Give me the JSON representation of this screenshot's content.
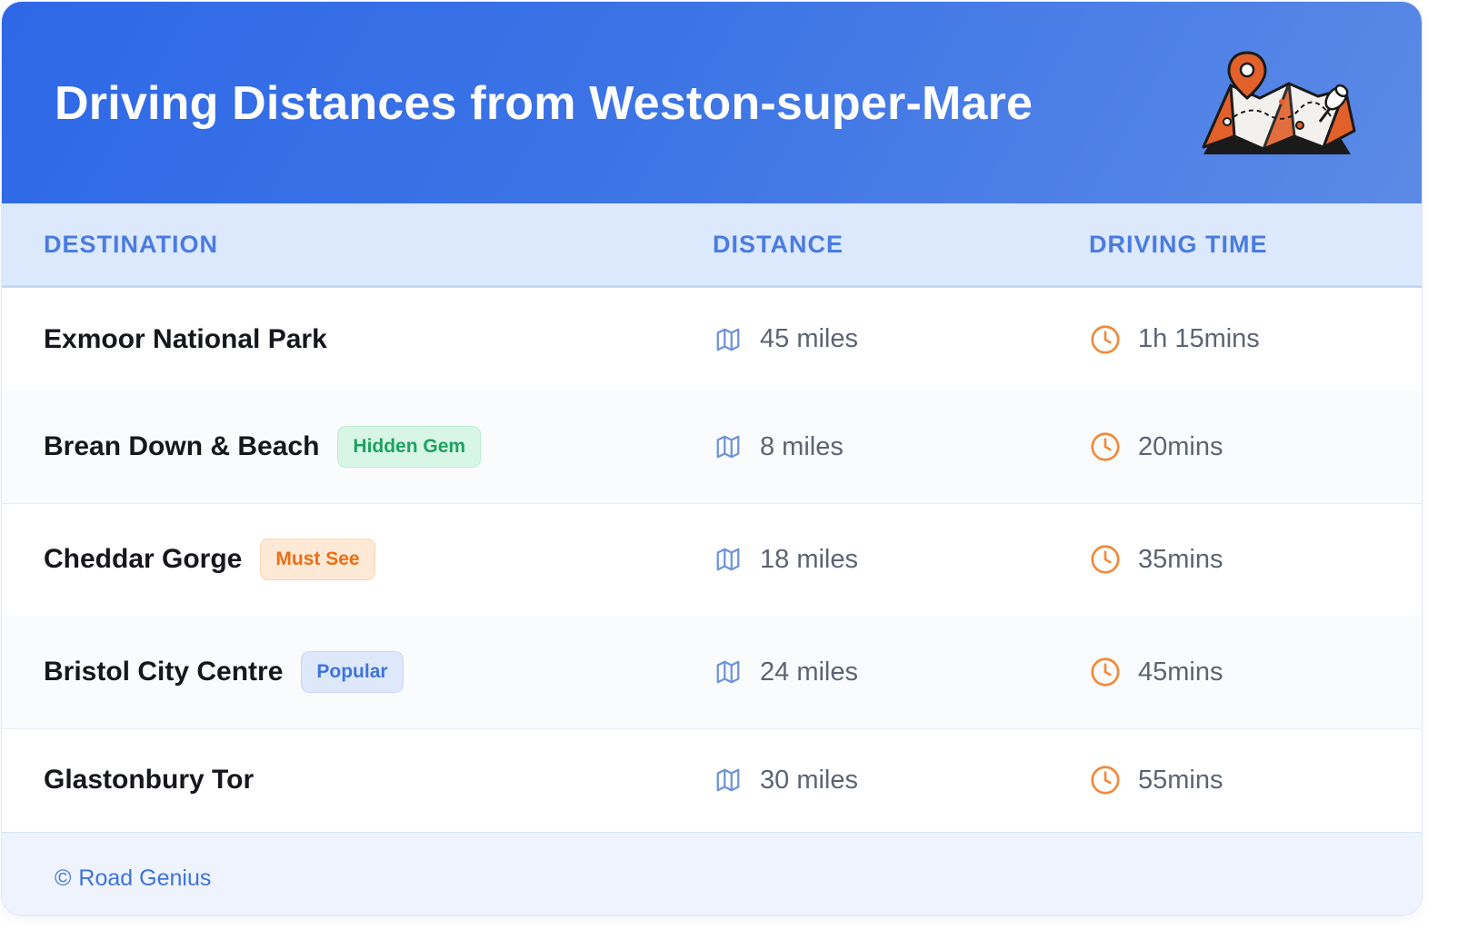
{
  "header": {
    "title": "Driving Distances from Weston-super-Mare",
    "illustration_icon": "map-with-pin-icon"
  },
  "table": {
    "columns": [
      "DESTINATION",
      "DISTANCE",
      "DRIVING TIME"
    ],
    "distance_icon": "map-icon",
    "time_icon": "clock-icon",
    "rows": [
      {
        "destination": "Exmoor National Park",
        "badge": "",
        "distance": "45 miles",
        "time": "1h 15mins"
      },
      {
        "destination": "Brean Down & Beach",
        "badge": "Hidden Gem",
        "badge_color": "#1ca25e",
        "distance": "8 miles",
        "time": "20mins"
      },
      {
        "destination": "Cheddar Gorge",
        "badge": "Must See",
        "badge_color": "#ee6d14",
        "distance": "18 miles",
        "time": "35mins"
      },
      {
        "destination": "Bristol City Centre",
        "badge": "Popular",
        "badge_color": "#3f73dd",
        "distance": "24 miles",
        "time": "45mins"
      },
      {
        "destination": "Glastonbury Tor",
        "badge": "",
        "distance": "30 miles",
        "time": "55mins"
      }
    ]
  },
  "footer": {
    "copyright_symbol": "©",
    "brand": "Road Genius"
  },
  "colors": {
    "header_start": "#2e68e6",
    "header_end": "#5b8ae6",
    "accent_blue": "#4a7be0",
    "clock_orange": "#f08a3c",
    "map_icon_blue": "#6f93d8"
  }
}
